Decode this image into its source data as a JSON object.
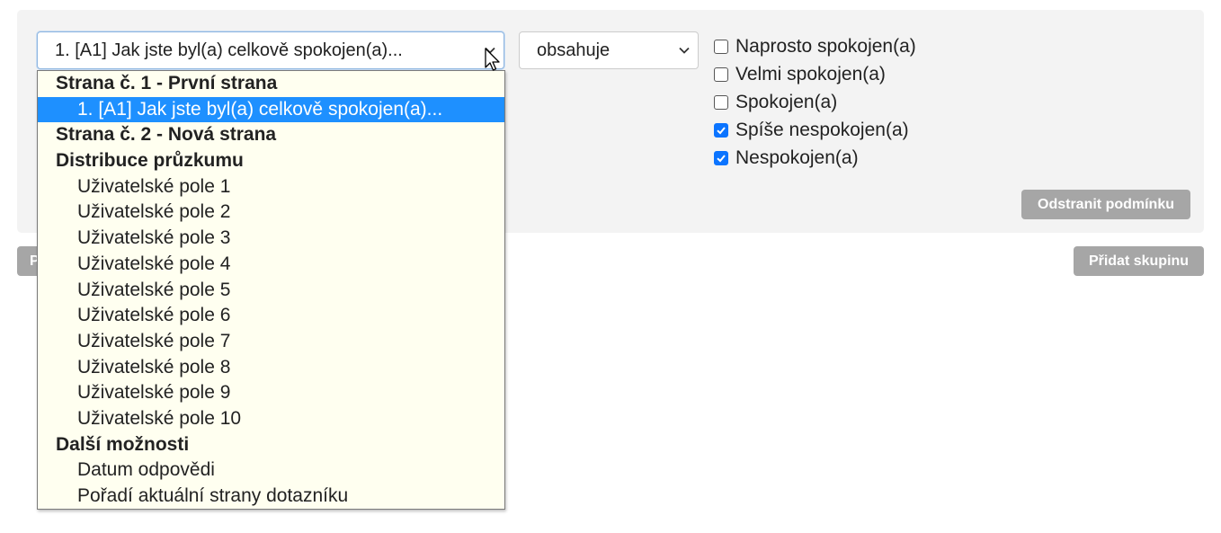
{
  "condition": {
    "question_select": {
      "value": "1. [A1] Jak jste byl(a) celkově spokojen(a)..."
    },
    "operator_select": {
      "value": "obsahuje"
    },
    "answers": [
      {
        "label": "Naprosto spokojen(a)",
        "checked": false
      },
      {
        "label": "Velmi spokojen(a)",
        "checked": false
      },
      {
        "label": "Spokojen(a)",
        "checked": false
      },
      {
        "label": "Spíše nespokojen(a)",
        "checked": true
      },
      {
        "label": "Nespokojen(a)",
        "checked": true
      }
    ],
    "remove_button": "Odstranit podmínku"
  },
  "footer": {
    "add_group_button": "Přidat skupinu",
    "left_button_partial": "P"
  },
  "dropdown": {
    "groups": [
      {
        "label": "Strana č. 1 - První strana",
        "options": [
          "1. [A1] Jak jste byl(a) celkově spokojen(a)..."
        ]
      },
      {
        "label": "Strana č. 2 - Nová strana",
        "options": []
      },
      {
        "label": "Distribuce průzkumu",
        "options": [
          "Uživatelské pole 1",
          "Uživatelské pole 2",
          "Uživatelské pole 3",
          "Uživatelské pole 4",
          "Uživatelské pole 5",
          "Uživatelské pole 6",
          "Uživatelské pole 7",
          "Uživatelské pole 8",
          "Uživatelské pole 9",
          "Uživatelské pole 10"
        ]
      },
      {
        "label": "Další možnosti",
        "options": [
          "Datum odpovědi",
          "Pořadí aktuální strany dotazníku"
        ]
      }
    ],
    "selected_option": "1. [A1] Jak jste byl(a) celkově spokojen(a)..."
  },
  "colors": {
    "highlight": "#1e90ff",
    "checkbox_checked": "#0b74ff",
    "button_gray": "#a6a6a6",
    "dropdown_bg": "#fffff0"
  },
  "icons": {
    "select_arrow": "chevron-down-icon",
    "checkbox_check": "checkmark-icon",
    "pointer": "mouse-cursor-icon"
  }
}
